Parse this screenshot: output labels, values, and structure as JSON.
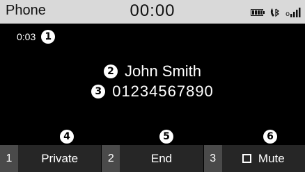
{
  "status_bar": {
    "app_title": "Phone",
    "clock": "00:00",
    "icons": [
      "battery-icon",
      "bluetooth-handsfree-icon",
      "signal-strength-icon"
    ]
  },
  "call": {
    "duration": "0:03",
    "caller_name": "John Smith",
    "phone_number": "01234567890"
  },
  "callouts": [
    "1",
    "2",
    "3",
    "4",
    "5",
    "6"
  ],
  "softkeys": [
    {
      "number": "1",
      "label": "Private"
    },
    {
      "number": "2",
      "label": "End"
    },
    {
      "number": "3",
      "label": "Mute",
      "checked": false
    }
  ],
  "colors": {
    "background": "#000000",
    "status_bar": "#d9d9d9",
    "softkey": "#262626",
    "softkey_number": "#4a4a4a",
    "text": "#ffffff"
  }
}
